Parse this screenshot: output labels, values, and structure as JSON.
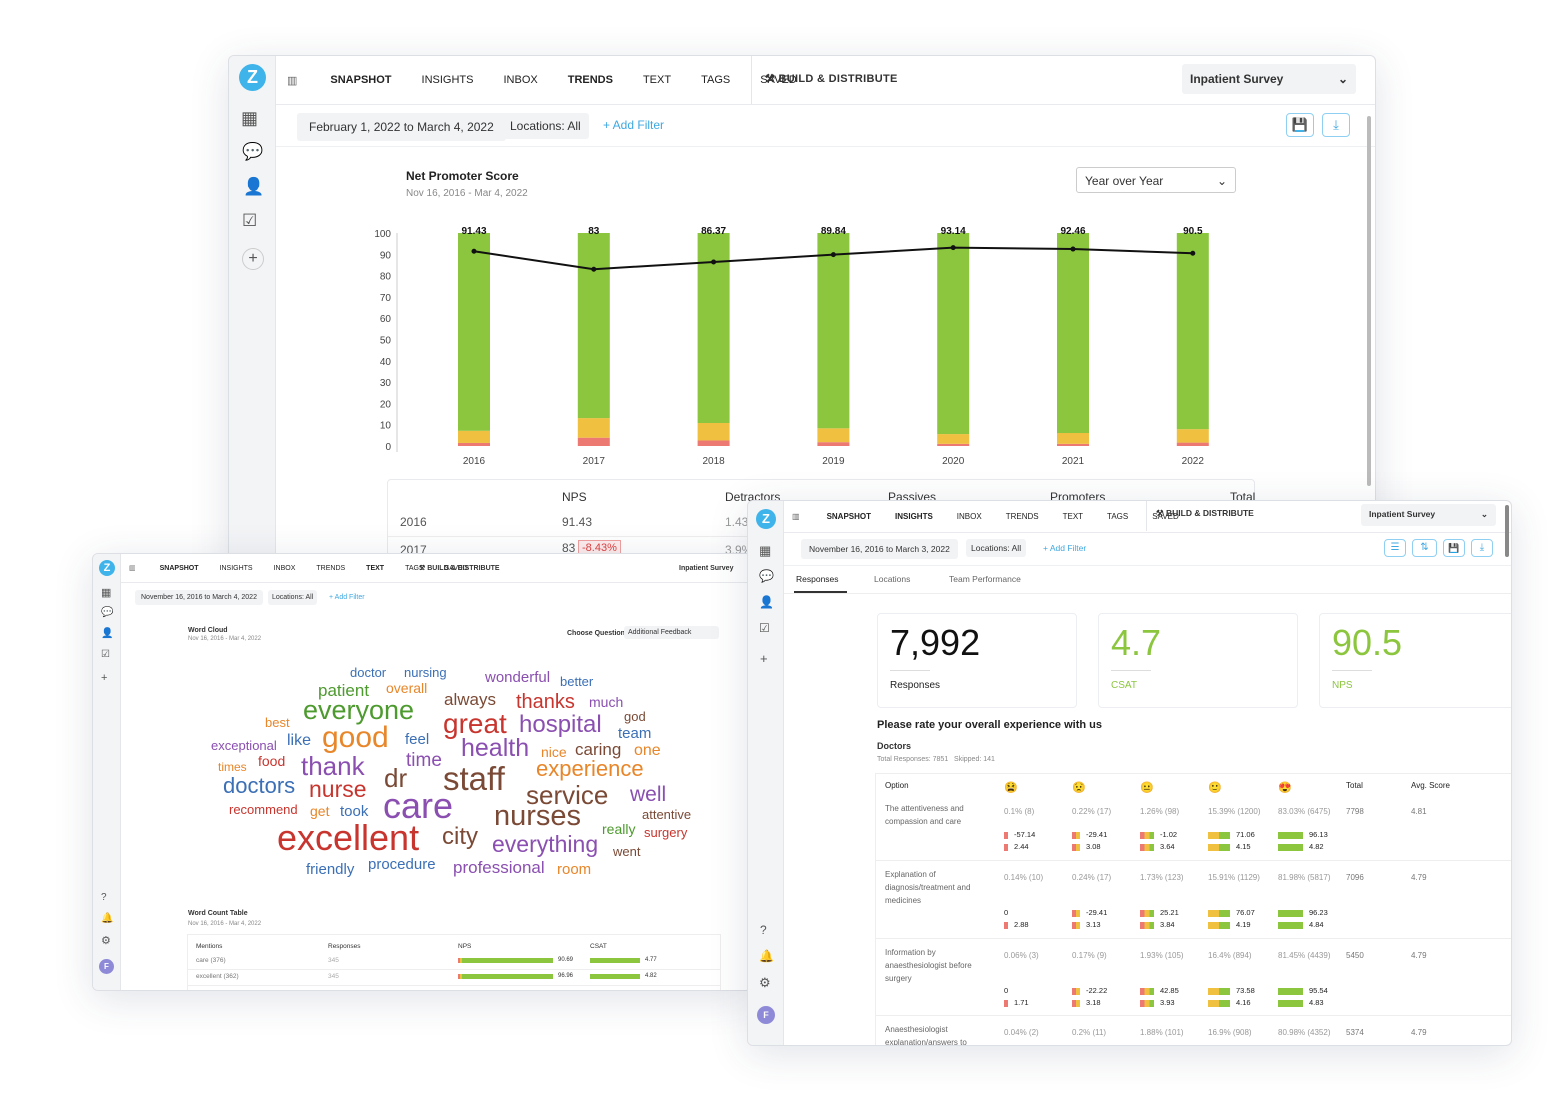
{
  "colors": {
    "brand": "#3fb4ea",
    "promoters": "#8cc63f",
    "passives": "#f0c040",
    "detractors": "#ec7a73",
    "line": "#111111",
    "negative": "#e04040"
  },
  "top": {
    "nav": [
      "Snapshot",
      "Insights",
      "Inbox",
      "Trends",
      "Text",
      "Tags",
      "Saved"
    ],
    "active": "Trends",
    "build": "Build & Distribute",
    "survey": "Inpatient Survey",
    "date_range": "February 1, 2022 to March 4, 2022",
    "locations": "Locations: All",
    "add_filter": "+ Add Filter",
    "compare": "Year over Year",
    "table": {
      "headers": [
        "NPS",
        "Detractors",
        "Passives",
        "Promoters",
        "Total"
      ],
      "rows": [
        {
          "year": "2016",
          "nps": "91.43",
          "det": "1.43"
        },
        {
          "year": "2017",
          "nps": "83",
          "change": "-8.43%",
          "det": "3.9%"
        }
      ]
    }
  },
  "chart_data": {
    "type": "bar",
    "title": "Net Promoter Score",
    "subtitle": "Nov 16, 2016 - Mar 4, 2022",
    "categories": [
      "2016",
      "2017",
      "2018",
      "2019",
      "2020",
      "2021",
      "2022"
    ],
    "ylim": [
      0,
      100
    ],
    "yticks": [
      0,
      10,
      20,
      30,
      40,
      50,
      60,
      70,
      80,
      90,
      100
    ],
    "series": [
      {
        "name": "Detractors",
        "values": [
          1.43,
          3.9,
          2.6,
          1.8,
          1.0,
          1.0,
          1.6
        ]
      },
      {
        "name": "Passives",
        "values": [
          5.7,
          9.2,
          8.2,
          6.5,
          4.6,
          5.1,
          6.3
        ]
      },
      {
        "name": "Promoters",
        "values": [
          92.87,
          86.9,
          89.2,
          91.7,
          94.4,
          93.9,
          92.1
        ]
      },
      {
        "name": "NPS",
        "type": "line",
        "values": [
          91.43,
          83,
          86.37,
          89.84,
          93.14,
          92.46,
          90.5
        ],
        "labels": [
          "91.43",
          "83",
          "86.37",
          "89.84",
          "93.14",
          "92.46",
          "90.5"
        ]
      }
    ],
    "grid": false,
    "stacked": true
  },
  "left": {
    "nav": [
      "Snapshot",
      "Insights",
      "Inbox",
      "Trends",
      "Text",
      "Tags",
      "Saved"
    ],
    "active": "Text",
    "build": "Build & Distribute",
    "survey": "Inpatient Survey",
    "date_range": "November 16, 2016 to March 4, 2022",
    "locations": "Locations: All",
    "add_filter": "+ Add Filter",
    "cloud_title": "Word Cloud",
    "cloud_sub": "Nov 16, 2016 - Mar 4, 2022",
    "choose_label": "Choose Question",
    "choose_value": "Additional Feedback",
    "words": [
      {
        "t": "doctor",
        "c": "#3b6fb6"
      },
      {
        "t": "nursing",
        "c": "#3b6fb6"
      },
      {
        "t": "wonderful",
        "c": "#8a4fb0"
      },
      {
        "t": "better",
        "c": "#3b6fb6"
      },
      {
        "t": "patient",
        "c": "#4d9a2e"
      },
      {
        "t": "overall",
        "c": "#e8862a"
      },
      {
        "t": "always",
        "c": "#7a4a36"
      },
      {
        "t": "thanks",
        "c": "#c8352e"
      },
      {
        "t": "much",
        "c": "#8a4fb0"
      },
      {
        "t": "god",
        "c": "#7a4a36"
      },
      {
        "t": "everyone",
        "c": "#4d9a2e"
      },
      {
        "t": "best",
        "c": "#e8862a"
      },
      {
        "t": "great",
        "c": "#c8352e"
      },
      {
        "t": "hospital",
        "c": "#8a4fb0"
      },
      {
        "t": "team",
        "c": "#3b6fb6"
      },
      {
        "t": "exceptional",
        "c": "#8a4fb0"
      },
      {
        "t": "like",
        "c": "#3b6fb6"
      },
      {
        "t": "good",
        "c": "#e8862a"
      },
      {
        "t": "feel",
        "c": "#3b6fb6"
      },
      {
        "t": "health",
        "c": "#8a4fb0"
      },
      {
        "t": "nice",
        "c": "#e8862a"
      },
      {
        "t": "caring",
        "c": "#7a4a36"
      },
      {
        "t": "one",
        "c": "#e8862a"
      },
      {
        "t": "food",
        "c": "#c8352e"
      },
      {
        "t": "time",
        "c": "#8a4fb0"
      },
      {
        "t": "thank",
        "c": "#8a4fb0"
      },
      {
        "t": "dr",
        "c": "#7a4a36"
      },
      {
        "t": "staff",
        "c": "#7a4a36"
      },
      {
        "t": "experience",
        "c": "#e8862a"
      },
      {
        "t": "times",
        "c": "#e8862a"
      },
      {
        "t": "doctors",
        "c": "#3b6fb6"
      },
      {
        "t": "nurse",
        "c": "#c8352e"
      },
      {
        "t": "service",
        "c": "#7a4a36"
      },
      {
        "t": "well",
        "c": "#8a4fb0"
      },
      {
        "t": "care",
        "c": "#8a4fb0"
      },
      {
        "t": "recommend",
        "c": "#c8352e"
      },
      {
        "t": "get",
        "c": "#e8862a"
      },
      {
        "t": "took",
        "c": "#3b6fb6"
      },
      {
        "t": "nurses",
        "c": "#7a4a36"
      },
      {
        "t": "attentive",
        "c": "#7a4a36"
      },
      {
        "t": "really",
        "c": "#4d9a2e"
      },
      {
        "t": "surgery",
        "c": "#c8352e"
      },
      {
        "t": "excellent",
        "c": "#c8352e"
      },
      {
        "t": "city",
        "c": "#7a4a36"
      },
      {
        "t": "everything",
        "c": "#8a4fb0"
      },
      {
        "t": "went",
        "c": "#7a4a36"
      },
      {
        "t": "friendly",
        "c": "#3b6fb6"
      },
      {
        "t": "procedure",
        "c": "#3b6fb6"
      },
      {
        "t": "professional",
        "c": "#8a4fb0"
      },
      {
        "t": "room",
        "c": "#e8862a"
      }
    ],
    "wc_title": "Word Count Table",
    "wc_sub": "Nov 16, 2016 - Mar 4, 2022",
    "wc_headers": [
      "Mentions",
      "Responses",
      "NPS",
      "CSAT"
    ],
    "wc_rows": [
      {
        "m": "care (376)",
        "r": "345",
        "nps": "90.69",
        "csat": "4.77"
      },
      {
        "m": "excellent (362)",
        "r": "345",
        "nps": "96.96",
        "csat": "4.82"
      }
    ],
    "avatar": "F"
  },
  "right": {
    "nav": [
      "Snapshot",
      "Insights",
      "Inbox",
      "Trends",
      "Text",
      "Tags",
      "Saved"
    ],
    "active": "Insights",
    "build": "Build & Distribute",
    "survey": "Inpatient Survey",
    "date_range": "November 16, 2016 to March 3, 2022",
    "locations": "Locations: All",
    "add_filter": "+ Add Filter",
    "tabs": [
      "Responses",
      "Locations",
      "Team Performance"
    ],
    "active_tab": "Responses",
    "cards": [
      {
        "value": "7,992",
        "label": "Responses"
      },
      {
        "value": "4.7",
        "label": "CSAT"
      },
      {
        "value": "90.5",
        "label": "NPS"
      }
    ],
    "question": "Please rate your overall experience with us",
    "group": "Doctors",
    "stats": "Total Responses: 7851   Skipped: 141",
    "headers": [
      "Option",
      "😫",
      "😟",
      "😐",
      "🙂",
      "😍",
      "Total",
      "Avg. Score"
    ],
    "rows": [
      {
        "option": "The attentiveness and compassion and care",
        "cells": [
          {
            "p": "0.1% (8)",
            "n": "-57.14",
            "c": "2.44"
          },
          {
            "p": "0.22% (17)",
            "n": "-29.41",
            "c": "3.08"
          },
          {
            "p": "1.26% (98)",
            "n": "-1.02",
            "c": "3.64"
          },
          {
            "p": "15.39% (1200)",
            "n": "71.06",
            "c": "4.15"
          },
          {
            "p": "83.03% (6475)",
            "n": "96.13",
            "c": "4.82"
          }
        ],
        "total": "7798",
        "avg": "4.81"
      },
      {
        "option": "Explanation of diagnosis/treatment and medicines",
        "cells": [
          {
            "p": "0.14% (10)",
            "n": "0",
            "c": "2.88"
          },
          {
            "p": "0.24% (17)",
            "n": "-29.41",
            "c": "3.13"
          },
          {
            "p": "1.73% (123)",
            "n": "25.21",
            "c": "3.84"
          },
          {
            "p": "15.91% (1129)",
            "n": "76.07",
            "c": "4.19"
          },
          {
            "p": "81.98% (5817)",
            "n": "96.23",
            "c": "4.84"
          }
        ],
        "total": "7096",
        "avg": "4.79"
      },
      {
        "option": "Information by anaesthesiologist before surgery",
        "cells": [
          {
            "p": "0.06% (3)",
            "n": "0",
            "c": "1.71"
          },
          {
            "p": "0.17% (9)",
            "n": "-22.22",
            "c": "3.18"
          },
          {
            "p": "1.93% (105)",
            "n": "42.85",
            "c": "3.93"
          },
          {
            "p": "16.4% (894)",
            "n": "73.58",
            "c": "4.16"
          },
          {
            "p": "81.45% (4439)",
            "n": "95.54",
            "c": "4.83"
          }
        ],
        "total": "5450",
        "avg": "4.79"
      },
      {
        "option": "Anaesthesiologist explanation/answers to",
        "cells": [
          {
            "p": "0.04% (2)"
          },
          {
            "p": "0.2% (11)"
          },
          {
            "p": "1.88% (101)"
          },
          {
            "p": "16.9% (908)"
          },
          {
            "p": "80.98% (4352)"
          }
        ],
        "total": "5374",
        "avg": "4.79"
      }
    ],
    "avatar": "F"
  }
}
